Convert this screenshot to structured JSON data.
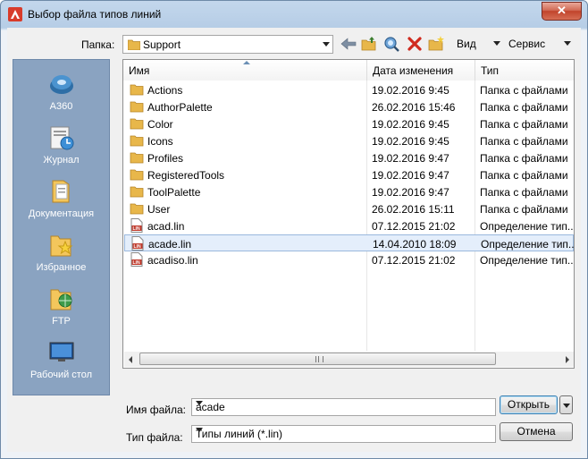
{
  "window": {
    "title": "Выбор файла типов линий",
    "close_symbol": "✕"
  },
  "toolbar": {
    "folder_label": "Папка:",
    "folder_value": "Support",
    "view_label": "Вид",
    "tools_label": "Сервис",
    "icons": [
      "back-icon",
      "up-folder-icon",
      "search-web-icon",
      "delete-icon",
      "new-folder-icon",
      "views-icon",
      "tools-icon"
    ]
  },
  "places": [
    {
      "label": "A360",
      "icon": "a360-icon"
    },
    {
      "label": "Журнал",
      "icon": "history-icon"
    },
    {
      "label": "Документация",
      "icon": "documents-icon"
    },
    {
      "label": "Избранное",
      "icon": "favorites-icon"
    },
    {
      "label": "FTP",
      "icon": "ftp-icon"
    },
    {
      "label": "Рабочий стол",
      "icon": "desktop-icon"
    }
  ],
  "file_list": {
    "columns": [
      "Имя",
      "Дата изменения",
      "Тип"
    ],
    "rows": [
      {
        "name": "Actions",
        "date": "19.02.2016 9:45",
        "type": "Папка с файлами",
        "kind": "folder"
      },
      {
        "name": "AuthorPalette",
        "date": "26.02.2016 15:46",
        "type": "Папка с файлами",
        "kind": "folder"
      },
      {
        "name": "Color",
        "date": "19.02.2016 9:45",
        "type": "Папка с файлами",
        "kind": "folder"
      },
      {
        "name": "Icons",
        "date": "19.02.2016 9:45",
        "type": "Папка с файлами",
        "kind": "folder"
      },
      {
        "name": "Profiles",
        "date": "19.02.2016 9:47",
        "type": "Папка с файлами",
        "kind": "folder"
      },
      {
        "name": "RegisteredTools",
        "date": "19.02.2016 9:47",
        "type": "Папка с файлами",
        "kind": "folder"
      },
      {
        "name": "ToolPalette",
        "date": "19.02.2016 9:47",
        "type": "Папка с файлами",
        "kind": "folder"
      },
      {
        "name": "User",
        "date": "26.02.2016 15:11",
        "type": "Папка с файлами",
        "kind": "folder"
      },
      {
        "name": "acad.lin",
        "date": "07.12.2015 21:02",
        "type": "Определение тип...",
        "kind": "lin"
      },
      {
        "name": "acade.lin",
        "date": "14.04.2010 18:09",
        "type": "Определение тип...",
        "kind": "lin",
        "selected": true
      },
      {
        "name": "acadiso.lin",
        "date": "07.12.2015 21:02",
        "type": "Определение тип...",
        "kind": "lin"
      }
    ]
  },
  "filename": {
    "label": "Имя файла:",
    "value": "acade"
  },
  "filetype": {
    "label": "Тип файла:",
    "value": "Типы линий (*.lin)"
  },
  "buttons": {
    "open": "Открыть",
    "cancel": "Отмена"
  },
  "colors": {
    "places_bg": "#8aa3c1",
    "selected_row": "#e4eefb",
    "folder": "#e8b74a",
    "lin_icon_red": "#c0392b"
  }
}
